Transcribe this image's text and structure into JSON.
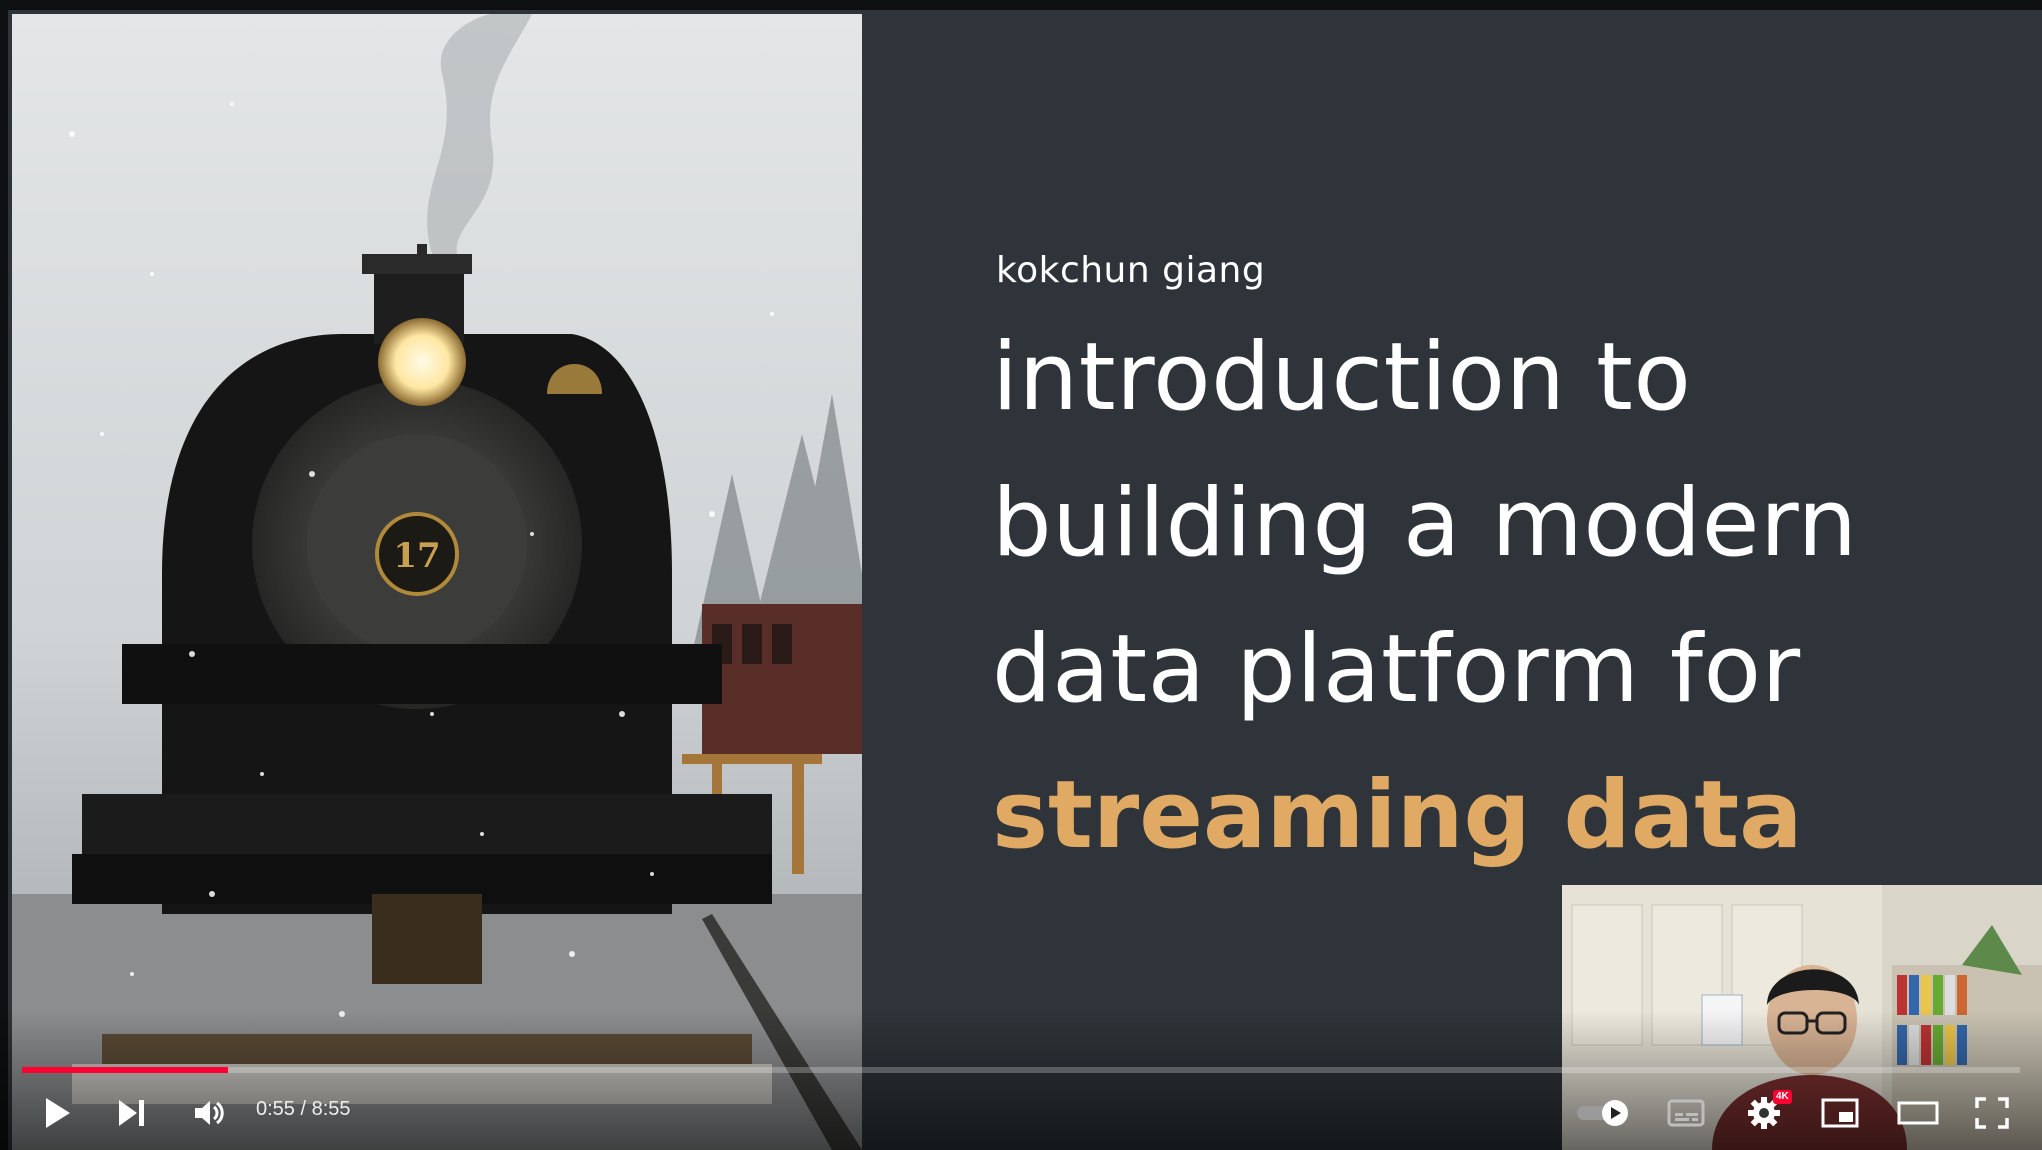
{
  "slide": {
    "speaker": "kokchun giang",
    "title_lines": [
      "introduction to",
      "building a modern",
      "data platform for"
    ],
    "title_accent": "streaming data",
    "accent_color": "#e0aa64",
    "background_color": "#2e3439"
  },
  "photo": {
    "locomotive_number": "17"
  },
  "player": {
    "current_time": "0:55",
    "separator": " / ",
    "duration": "8:55",
    "progress_fraction": 0.103,
    "buffered_fraction": 0.103,
    "progress_color": "#ff0033",
    "settings_badge": "4K",
    "controls": {
      "play": "play-icon",
      "next": "next-icon",
      "volume": "volume-icon",
      "autoplay": "autoplay-toggle-icon",
      "subtitles": "subtitles-icon",
      "settings": "gear-icon",
      "miniplayer": "miniplayer-icon",
      "theater": "theater-mode-icon",
      "fullscreen": "fullscreen-icon"
    }
  }
}
